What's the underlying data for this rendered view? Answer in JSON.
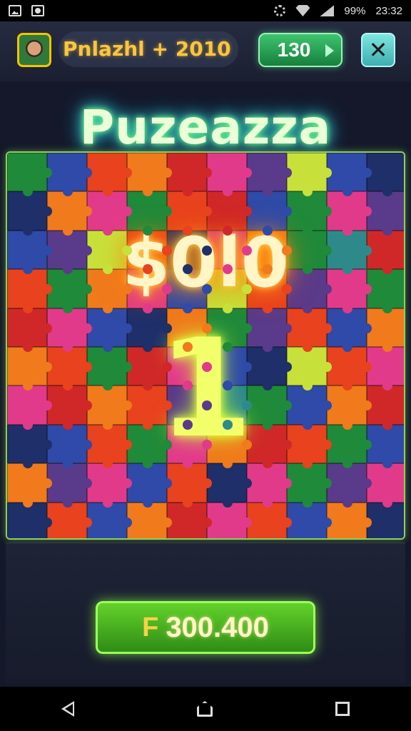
{
  "status_bar": {
    "battery": "99%",
    "time": "23:32"
  },
  "header": {
    "player_name": "Pnlazhl + 2010",
    "coins": "130"
  },
  "game": {
    "title": "Puzeazza",
    "score": "$0l0",
    "level": "1"
  },
  "reward_button": {
    "icon": "F",
    "value": "300.400"
  },
  "colors": {
    "pieces": [
      "#1f8a3a",
      "#e8421e",
      "#e23a8a",
      "#2f4aa8",
      "#f07a1c",
      "#c8e03a",
      "#5a3a8a",
      "#1e2f6a",
      "#d02828",
      "#2e8a8a"
    ],
    "accent_green": "#9bff5a",
    "title_glow": "#39e0c8",
    "score_glow": "#ff9a1a"
  }
}
